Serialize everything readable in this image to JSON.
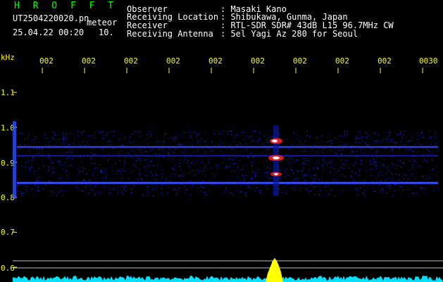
{
  "app": {
    "title": "H R O F F T",
    "file_name": "UT2504220020.pn",
    "event_type": "meteor",
    "date_time": "25.04.22 00:20",
    "count": "10."
  },
  "header": {
    "rows": [
      {
        "label": "Observer",
        "value": ": Masaki Kano"
      },
      {
        "label": "Receiving Location",
        "value": ": Shibukawa, Gunma, Japan"
      },
      {
        "label": "Receiver",
        "value": ": RTL-SDR SDR# 43dB L15 96.7MHz CW"
      },
      {
        "label": "Receiving Antenna",
        "value": ": 5el Yagi Az 280 for Seoul"
      }
    ]
  },
  "axes": {
    "y_unit": "kHz",
    "x_tick_labels": [
      "002",
      "002",
      "002",
      "002",
      "002",
      "002",
      "002",
      "002",
      "002",
      "0030"
    ],
    "y_tick_labels": [
      "1.1",
      "1.0",
      "0.9",
      "0.8",
      "0.7",
      "0.6"
    ]
  },
  "colors": {
    "background": "#000000",
    "title": "#00ff00",
    "text": "#ffffff",
    "axis": "#ffff00",
    "spectrogram": "#0000ff",
    "signal_strength": "#00ffff"
  }
}
